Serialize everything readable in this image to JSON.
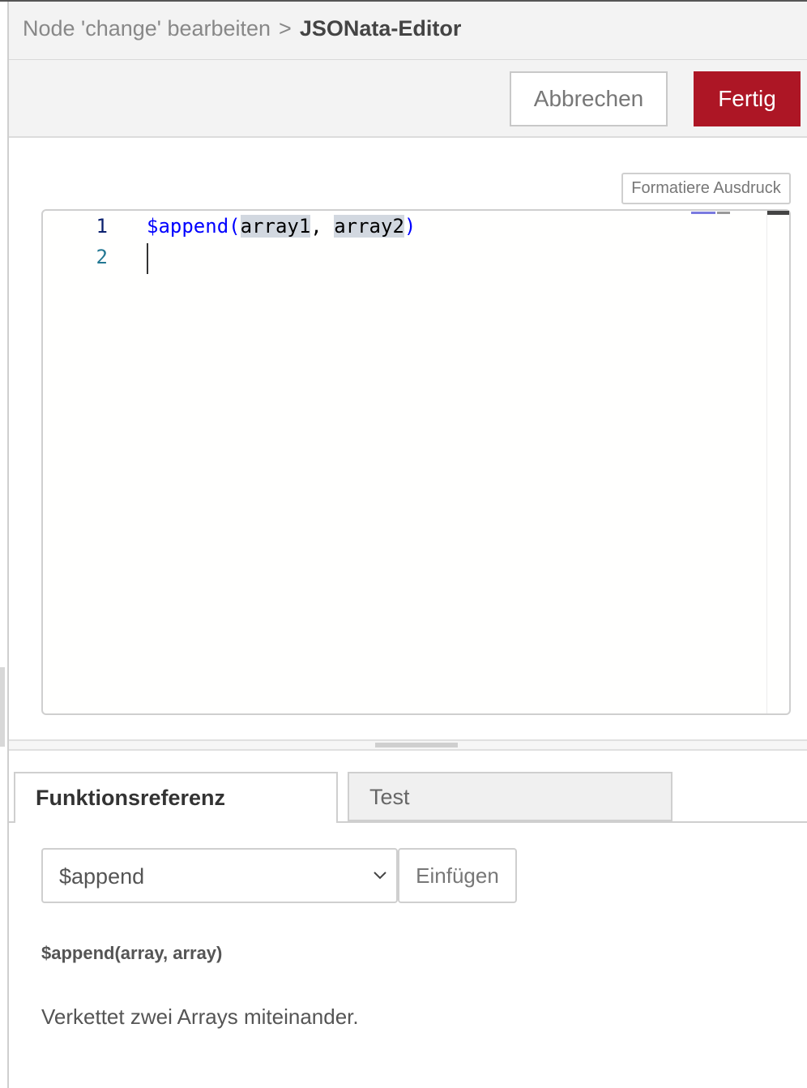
{
  "header": {
    "breadcrumb_parent": "Node 'change' bearbeiten",
    "breadcrumb_separator": ">",
    "breadcrumb_current": "JSONata-Editor"
  },
  "toolbar": {
    "cancel_label": "Abbrechen",
    "done_label": "Fertig",
    "done_color": "#ad1625"
  },
  "editor": {
    "format_label": "Formatiere Ausdruck",
    "lines": [
      {
        "number": "1",
        "fn": "$append(",
        "arg1": "array1",
        "comma": ", ",
        "arg2": "array2",
        "close": ")"
      },
      {
        "number": "2"
      }
    ],
    "keyword_color": "#0000ff",
    "line_number_color": "#237893"
  },
  "tabs": [
    {
      "label": "Funktionsreferenz",
      "active": true
    },
    {
      "label": "Test",
      "active": false
    }
  ],
  "reference": {
    "selected_function": "$append",
    "insert_label": "Einfügen",
    "signature": "$append(array, array)",
    "description": "Verkettet zwei Arrays miteinander."
  },
  "icons": {
    "select_arrow": "chevron-down-icon"
  }
}
